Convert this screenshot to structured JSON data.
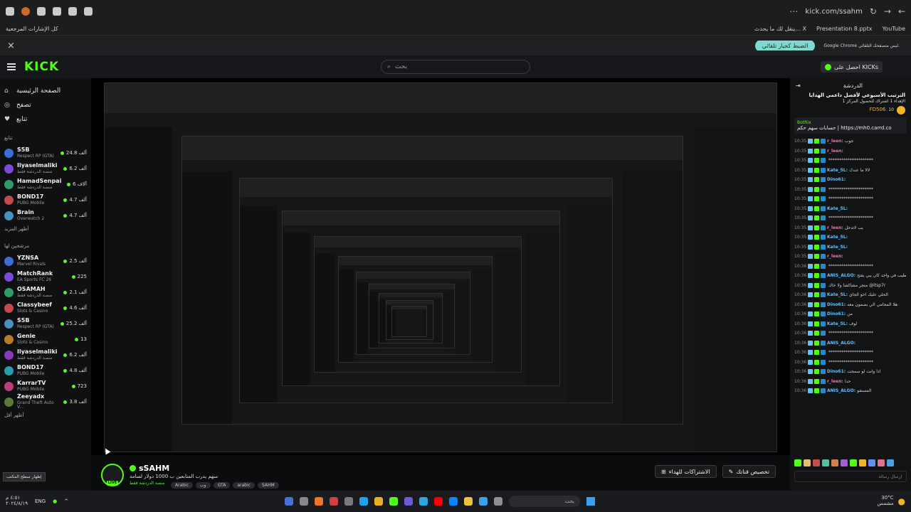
{
  "browser": {
    "url": "kick.com/ssahm",
    "bookmarks_left": "كل الإشارات المرجعية",
    "bookmarks_right": [
      "ينقل لك ما يحدث... X",
      "Presentation 8.pptx",
      "YouTube"
    ]
  },
  "infobar": {
    "message": "Google Chrome ليس متصفحك التلقائي.",
    "button": "الضبط كخيار تلقائي"
  },
  "header": {
    "logo": "KICK",
    "search_placeholder": "بحث",
    "get_kicks": "احصل على KICKs"
  },
  "sidebar": {
    "nav": [
      {
        "label": "الصفحة الرئيسية",
        "icon": "home-icon"
      },
      {
        "label": "تصفح",
        "icon": "compass-icon"
      },
      {
        "label": "تتابع",
        "icon": "heart-icon"
      }
    ],
    "following_title": "تتابع",
    "following": [
      {
        "name": "S5B",
        "cat": "Respect RP (GTA)",
        "viewers": "24.8 ألف"
      },
      {
        "name": "Ilyaselmaliki",
        "cat": "منصة الدردشة فقط",
        "viewers": "6.2 ألف"
      },
      {
        "name": "HamadSenpai",
        "cat": "منصة الدردشة فقط",
        "viewers": "6 آلاف"
      },
      {
        "name": "BOND17",
        "cat": "PUBG Mobile",
        "viewers": "4.7 ألف"
      },
      {
        "name": "Brain",
        "cat": "Overwatch 2",
        "viewers": "4.7 ألف"
      }
    ],
    "show_more": "أظهر المزيد",
    "recommended_title": "مرشحين لها",
    "recommended": [
      {
        "name": "YZNSA",
        "cat": "Marvel Rivals",
        "viewers": "2.5 ألف"
      },
      {
        "name": "MatchRank",
        "cat": "EA Sports FC 26",
        "viewers": "225"
      },
      {
        "name": "OSAMAH",
        "cat": "منصة الدردشة فقط",
        "viewers": "2.1 ألف"
      },
      {
        "name": "Classybeef",
        "cat": "Slots & Casino",
        "viewers": "4.6 ألف"
      },
      {
        "name": "S5B",
        "cat": "Respect RP (GTA)",
        "viewers": "25.2 ألف"
      },
      {
        "name": "Genie",
        "cat": "Slots & Casino",
        "viewers": "13"
      },
      {
        "name": "Ilyaselmaliki",
        "cat": "منصة الدردشة فقط",
        "viewers": "6.2 ألف"
      },
      {
        "name": "BOND17",
        "cat": "PUBG Mobile",
        "viewers": "4.8 ألف"
      },
      {
        "name": "KarrarTV",
        "cat": "PUBG Mobile",
        "viewers": "723"
      },
      {
        "name": "Zeeyadx",
        "cat": "Grand Theft Auto V...",
        "viewers": "3.8 ألف"
      }
    ],
    "show_less": "أظهر أقل"
  },
  "stream": {
    "name": "sSAHM",
    "live": "LIVE",
    "title": "سهم يدرب المتابعين ب 1000 دولار لسامة",
    "category": "منصة الدردشة فقط",
    "tags": [
      "Arabic",
      "وب",
      "GTA",
      "arabic",
      "SAHM"
    ],
    "btn_subscribe": "الاشتراكات للهداء",
    "btn_custom": "تخصيص قناتك"
  },
  "chat": {
    "title": "الدردشة",
    "promo_title": "الترتيب الأسبوعي لأفضل داعمي الهدايا",
    "promo_sub": "الإهداء 1 اشتراك للحصول المركز 1",
    "top_user": "FD506",
    "top_count": "10",
    "pinned_user": "BotRix",
    "pinned_text": "حسابات سهم حكم | https://mh0.carrd.co",
    "messages": [
      {
        "t": "10:35",
        "u": "r_leen:",
        "c": "#ff6aa0",
        "m": "جوب"
      },
      {
        "t": "10:35",
        "u": "r_leen:",
        "c": "#ff6aa0",
        "m": ""
      },
      {
        "t": "10:35",
        "u": "",
        "c": "#ddd",
        "m": "*********************"
      },
      {
        "t": "10:35",
        "u": "Kate_5L:",
        "c": "#5ec4ff",
        "m": "لالا ما عندك"
      },
      {
        "t": "10:35",
        "u": "Dino61:",
        "c": "#5ec4ff",
        "m": ""
      },
      {
        "t": "10:35",
        "u": "",
        "c": "#ddd",
        "m": "*********************"
      },
      {
        "t": "10:35",
        "u": "",
        "c": "#ddd",
        "m": "*********************"
      },
      {
        "t": "10:35",
        "u": "Kate_5L:",
        "c": "#5ec4ff",
        "m": ""
      },
      {
        "t": "10:35",
        "u": "",
        "c": "#ddd",
        "m": "*********************"
      },
      {
        "t": "10:35",
        "u": "r_leen:",
        "c": "#ff6aa0",
        "m": "يب لاتدخل"
      },
      {
        "t": "10:35",
        "u": "Kate_5L:",
        "c": "#5ec4ff",
        "m": ""
      },
      {
        "t": "10:35",
        "u": "Kate_5L:",
        "c": "#5ec4ff",
        "m": ""
      },
      {
        "t": "10:35",
        "u": "r_leen:",
        "c": "#ff6aa0",
        "m": ""
      },
      {
        "t": "10:36",
        "u": "",
        "c": "#ddd",
        "m": "*********************"
      },
      {
        "t": "10:36",
        "u": "ANIS_ALGO:",
        "c": "#5ec4ff",
        "m": "طيب في واحد كان يبي يفتح"
      },
      {
        "t": "10:36",
        "u": "",
        "c": "#ddd",
        "m": "متجر مشاكشا ولا خاك @itsp7r"
      },
      {
        "t": "10:36",
        "u": "Kate_5L:",
        "c": "#5ec4ff",
        "m": "الحلي عليك اخو الجاي"
      },
      {
        "t": "10:36",
        "u": "Dino61:",
        "c": "#5ec4ff",
        "m": "هلا المحامي الي بصمون معه"
      },
      {
        "t": "10:36",
        "u": "Dino61:",
        "c": "#5ec4ff",
        "m": "من"
      },
      {
        "t": "10:36",
        "u": "Kate_5L:",
        "c": "#5ec4ff",
        "m": "لوف"
      },
      {
        "t": "10:36",
        "u": "",
        "c": "#ddd",
        "m": "*********************"
      },
      {
        "t": "10:36",
        "u": "ANIS_ALGO:",
        "c": "#5ec4ff",
        "m": ""
      },
      {
        "t": "10:36",
        "u": "",
        "c": "#ddd",
        "m": "*********************"
      },
      {
        "t": "10:36",
        "u": "",
        "c": "#ddd",
        "m": "*********************"
      },
      {
        "t": "10:36",
        "u": "Dino61:",
        "c": "#5ec4ff",
        "m": "اذا وانت لو سمحت"
      },
      {
        "t": "10:36",
        "u": "r_leen:",
        "c": "#ff6aa0",
        "m": "حدا"
      },
      {
        "t": "10:36",
        "u": "ANIS_ALGO:",
        "c": "#5ec4ff",
        "m": "المستفو"
      }
    ],
    "send_placeholder": "إرسال رسالة",
    "emote_label": "المتابعين فقط"
  },
  "taskbar": {
    "time": "٤:٥١ م",
    "date": "٢٠٢٤/٨/١٩",
    "lang": "ENG",
    "search": "بحث",
    "weather": "30°C",
    "weather_sub": "مشمس",
    "tooltip": "إظهار سطح المكتب"
  }
}
